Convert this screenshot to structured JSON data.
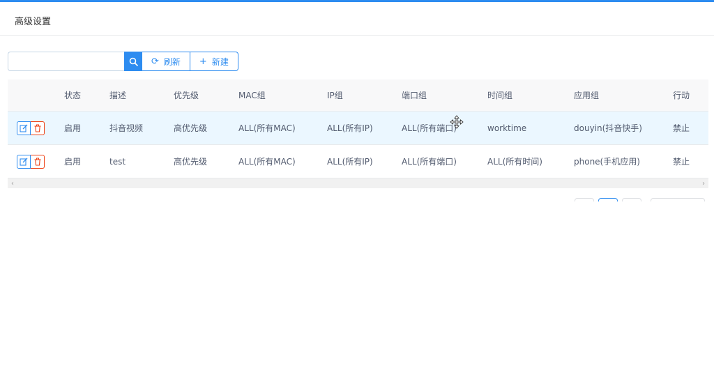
{
  "header": {
    "title": "高级设置"
  },
  "toolbar": {
    "search_placeholder": "",
    "refresh_label": "刷新",
    "new_label": "新建",
    "refresh_glyph": "⟳",
    "new_glyph": "+"
  },
  "table": {
    "columns": [
      "状态",
      "描述",
      "优先级",
      "MAC组",
      "IP组",
      "端口组",
      "时间组",
      "应用组",
      "行动"
    ],
    "rows": [
      {
        "status": "启用",
        "desc": "抖音视频",
        "priority": "高优先级",
        "mac": "ALL(所有MAC)",
        "ip": "ALL(所有IP)",
        "port": "ALL(所有端口)",
        "time": "worktime",
        "app": "douyin(抖音快手)",
        "action": "禁止"
      },
      {
        "status": "启用",
        "desc": "test",
        "priority": "高优先级",
        "mac": "ALL(所有MAC)",
        "ip": "ALL(所有IP)",
        "port": "ALL(所有端口)",
        "time": "ALL(所有时间)",
        "app": "phone(手机应用)",
        "action": "禁止"
      }
    ]
  },
  "icons": {
    "search": "search-icon",
    "edit": "edit-icon",
    "delete": "trash-icon",
    "scroll_left": "‹",
    "scroll_right": "›"
  },
  "colors": {
    "accent": "#2d8cf0",
    "danger": "#ed4014",
    "selected_row": "#ebf7ff"
  }
}
